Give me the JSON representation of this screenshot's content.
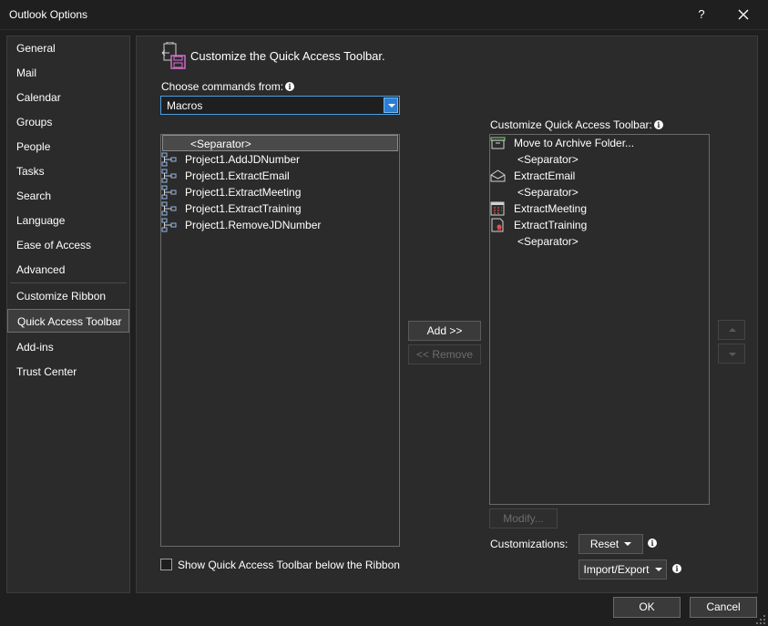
{
  "window": {
    "title": "Outlook Options",
    "help": "?"
  },
  "nav": {
    "items": [
      "General",
      "Mail",
      "Calendar",
      "Groups",
      "People",
      "Tasks",
      "Search",
      "Language",
      "Ease of Access",
      "Advanced",
      "Customize Ribbon",
      "Quick Access Toolbar",
      "Add-ins",
      "Trust Center"
    ],
    "selected": "Quick Access Toolbar"
  },
  "header": {
    "title": "Customize the Quick Access Toolbar."
  },
  "choose": {
    "label": "Choose commands from:",
    "value": "Macros"
  },
  "commands": [
    {
      "label": "<Separator>",
      "icon": "none",
      "selected": true
    },
    {
      "label": "Project1.AddJDNumber",
      "icon": "macro-icon"
    },
    {
      "label": "Project1.ExtractEmail",
      "icon": "macro-icon"
    },
    {
      "label": "Project1.ExtractMeeting",
      "icon": "macro-icon"
    },
    {
      "label": "Project1.ExtractTraining",
      "icon": "macro-icon"
    },
    {
      "label": "Project1.RemoveJDNumber",
      "icon": "macro-icon"
    }
  ],
  "qat": {
    "label": "Customize Quick Access Toolbar:",
    "items": [
      {
        "label": "Move to Archive Folder...",
        "icon": "archive-icon"
      },
      {
        "label": "<Separator>",
        "icon": "none"
      },
      {
        "label": "ExtractEmail",
        "icon": "envelope-icon"
      },
      {
        "label": "<Separator>",
        "icon": "none"
      },
      {
        "label": "ExtractMeeting",
        "icon": "calendar-icon"
      },
      {
        "label": "ExtractTraining",
        "icon": "certificate-icon"
      },
      {
        "label": "<Separator>",
        "icon": "none"
      }
    ]
  },
  "buttons": {
    "add": "Add >>",
    "remove": "<< Remove",
    "modify": "Modify...",
    "reset": "Reset",
    "import_export": "Import/Export",
    "ok": "OK",
    "cancel": "Cancel"
  },
  "customizations_label": "Customizations:",
  "checkbox_label": "Show Quick Access Toolbar below the Ribbon",
  "colors": {
    "accent": "#2a7fd4",
    "background": "#2b2b2b",
    "chrome": "#1f1f1f"
  }
}
